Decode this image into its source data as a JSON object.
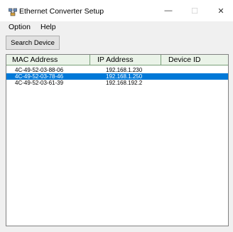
{
  "window": {
    "title": "Ethernet Converter Setup",
    "controls": {
      "minimize": "—",
      "maximize": "☐",
      "close": "✕"
    },
    "icon": "network-app-icon"
  },
  "menu": {
    "option": "Option",
    "help": "Help"
  },
  "toolbar": {
    "search_label": "Search Device"
  },
  "device_list": {
    "columns": [
      "MAC  Address",
      "IP  Address",
      "Device  ID"
    ],
    "rows": [
      {
        "mac": "4C-49-52-03-88-06",
        "ip": "192.168.1.230",
        "device_id": "",
        "selected": false
      },
      {
        "mac": "4C-49-52-03-78-46",
        "ip": "192.168.1.250",
        "device_id": "",
        "selected": true
      },
      {
        "mac": "4C-49-52-03-61-39",
        "ip": "192.168.192.2",
        "device_id": "",
        "selected": false
      }
    ]
  },
  "colors": {
    "selection": "#0078d7",
    "header_bg": "#eaf3e8",
    "window_bg": "#f0f0f0"
  }
}
